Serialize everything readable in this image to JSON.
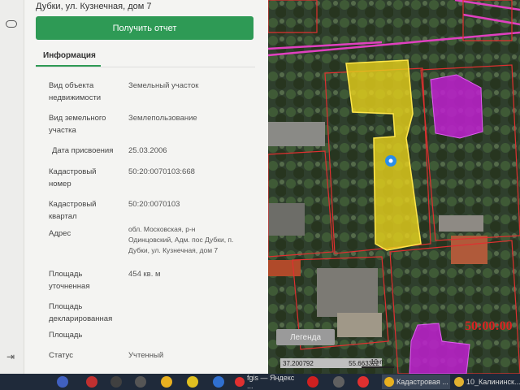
{
  "header": {
    "address": "Дубки, ул. Кузнечная, дом 7"
  },
  "actions": {
    "report_button": "Получить отчет"
  },
  "tabs": {
    "info": "Информация"
  },
  "fields": [
    {
      "label": "Вид объекта\nнедвижимости",
      "value": "Земельный участок"
    },
    {
      "label": "Вид земельного\nучастка",
      "value": "Землепользование"
    },
    {
      "label": "Дата присвоения",
      "value": "25.03.2006"
    },
    {
      "label": "Кадастровый\nномер",
      "value": "50:20:0070103:668"
    },
    {
      "label": "Кадастровый\nквартал",
      "value": "50:20:0070103"
    },
    {
      "label": "Адрес",
      "value": "обл. Московская, р-н\nОдинцовский, Адм. пос Дубки, п.\nДубки, ул. Кузнечная, дом 7"
    },
    {
      "label": "Площадь\nуточненная",
      "value": "454 кв. м"
    },
    {
      "label": "Площадь\nдекларированная",
      "value": ""
    },
    {
      "label": "Площадь",
      "value": ""
    },
    {
      "label": "Статус",
      "value": "Учтенный"
    }
  ],
  "map": {
    "legend_button": "Легенда",
    "scale_label": "50:00:00",
    "lon": "37.200792",
    "lat": "55.663322",
    "scale_text": "10 m",
    "parcel_color": "#e8d21c",
    "building_color": "#c020d0",
    "boundary_color": "#e03030",
    "road_color": "#e040c0"
  },
  "taskbar": {
    "items": [
      {
        "label": "fgis — Яндекс ...",
        "icon": "yandex-icon"
      },
      {
        "label": "Кадастровая ...",
        "icon": "chrome-icon"
      },
      {
        "label": "10_Калининск...",
        "icon": "folder-icon"
      }
    ]
  }
}
